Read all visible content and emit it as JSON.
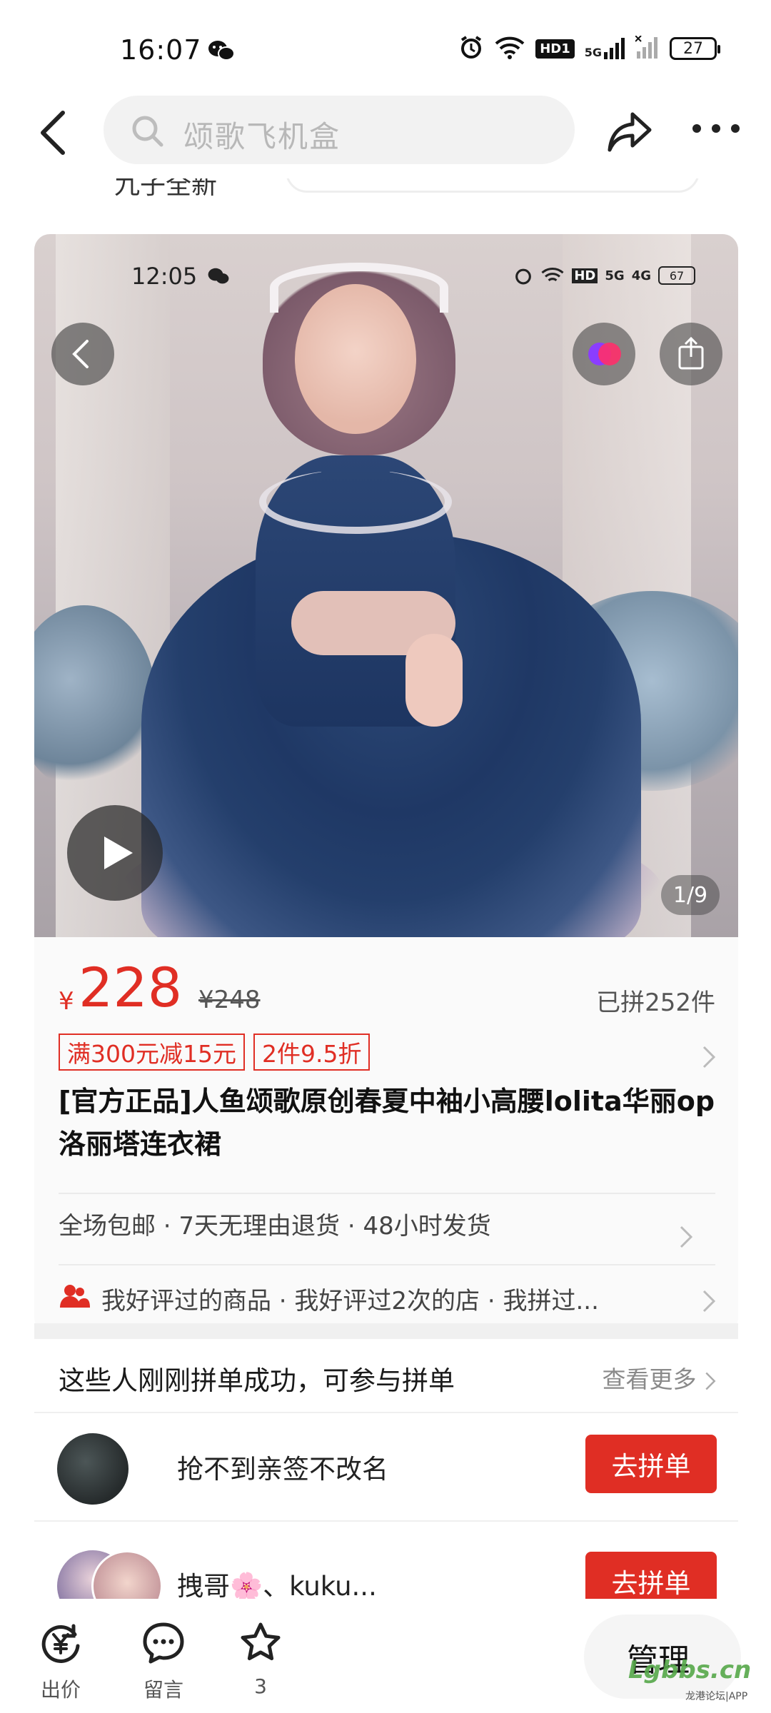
{
  "status_bar": {
    "time": "16:07",
    "hd_label": "HD1",
    "network": "5G",
    "battery": "27"
  },
  "nav": {
    "search_placeholder": "颂歌飞机盒"
  },
  "subrow": {
    "text": "九子全新"
  },
  "hero": {
    "time": "12:05",
    "hd_label": "HD",
    "network_a": "5G",
    "network_b": "4G",
    "battery": "67",
    "counter": "1/9"
  },
  "product": {
    "currency": "¥",
    "price": "228",
    "original_price": "¥248",
    "sold": "已拼252件",
    "tags": [
      "满300元减15元",
      "2件9.5折"
    ],
    "title": "[官方正品]人鱼颂歌原创春夏中袖小高腰lolita华丽op洛丽塔连衣裙",
    "service": "全场包邮 · 7天无理由退货 · 48小时发货",
    "social": "我好评过的商品 · 我好评过2次的店 · 我拼过..."
  },
  "group": {
    "title": "这些人刚刚拼单成功，可参与拼单",
    "more": "查看更多",
    "rows": [
      {
        "name": "抢不到亲签不改名",
        "button": "去拼单"
      },
      {
        "name": "拽哥🌸、kuku...",
        "button": "去拼单"
      }
    ]
  },
  "bottom": {
    "items": [
      {
        "label": "出价"
      },
      {
        "label": "留言"
      },
      {
        "label": "3"
      }
    ],
    "manage": "管理",
    "watermark": "Lgbbs.cn",
    "watermark_sub": "龙港论坛|APP"
  },
  "colors": {
    "accent": "#e02e24",
    "search_bg": "#f2f2f2"
  }
}
